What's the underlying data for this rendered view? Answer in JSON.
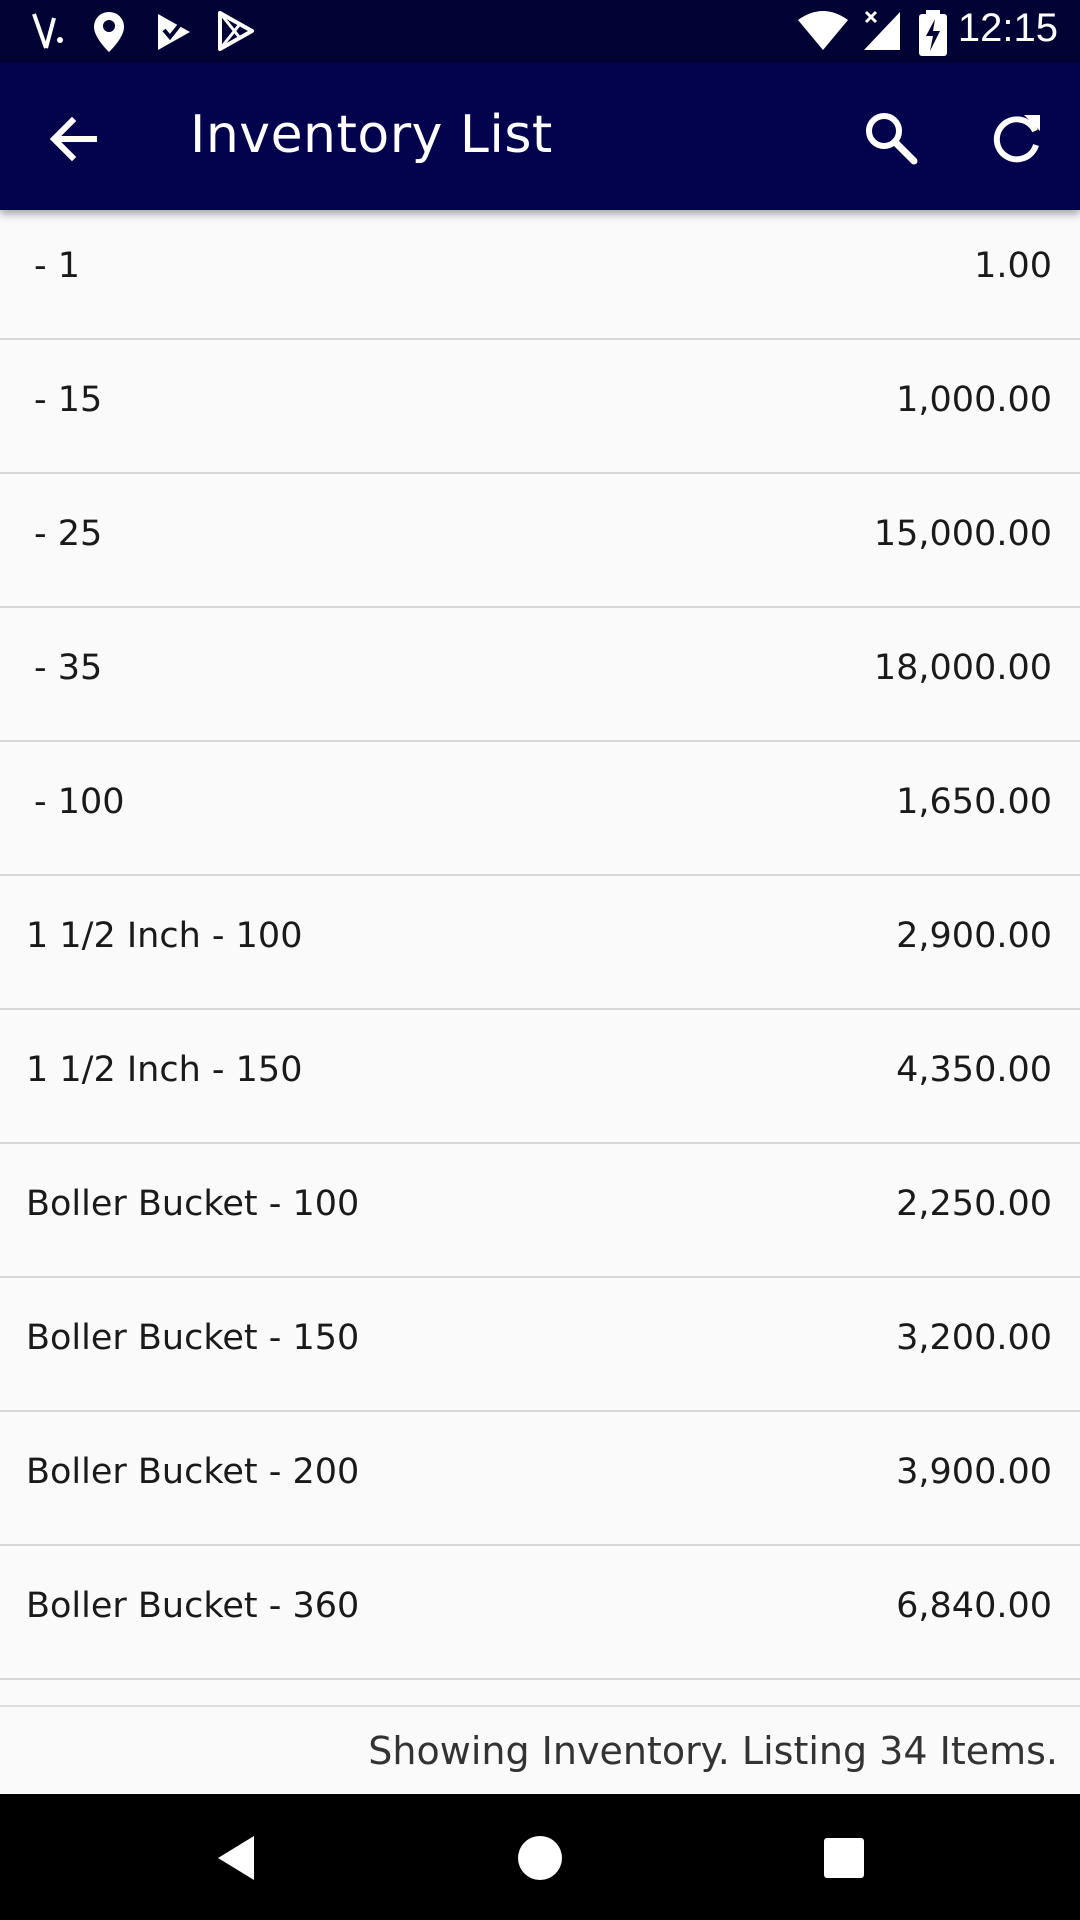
{
  "status_bar": {
    "time": "12:15",
    "icons": [
      "signal-app-icon",
      "location-icon",
      "check-flag-icon",
      "play-store-icon",
      "wifi-icon",
      "cell-signal-icon",
      "battery-charging-icon"
    ]
  },
  "app_bar": {
    "title": "Inventory List",
    "back_icon": "arrow-back-icon",
    "search_icon": "search-icon",
    "refresh_icon": "refresh-icon",
    "background": "#03034d"
  },
  "inventory": {
    "items": [
      {
        "name": "- 1",
        "amount": "1.00"
      },
      {
        "name": "- 15",
        "amount": "1,000.00"
      },
      {
        "name": "- 25",
        "amount": "15,000.00"
      },
      {
        "name": "- 35",
        "amount": "18,000.00"
      },
      {
        "name": "- 100",
        "amount": "1,650.00"
      },
      {
        "name": "1 1/2 Inch - 100",
        "amount": "2,900.00"
      },
      {
        "name": "1 1/2 Inch - 150",
        "amount": "4,350.00"
      },
      {
        "name": "Boller Bucket - 100",
        "amount": "2,250.00"
      },
      {
        "name": "Boller Bucket - 150",
        "amount": "3,200.00"
      },
      {
        "name": "Boller Bucket - 200",
        "amount": "3,900.00"
      },
      {
        "name": "Boller Bucket - 360",
        "amount": "6,840.00"
      }
    ]
  },
  "footer": {
    "status_text": "Showing Inventory. Listing 34 Items."
  },
  "nav_bar": {
    "icons": [
      "back-triangle-icon",
      "home-circle-icon",
      "recents-square-icon"
    ]
  }
}
